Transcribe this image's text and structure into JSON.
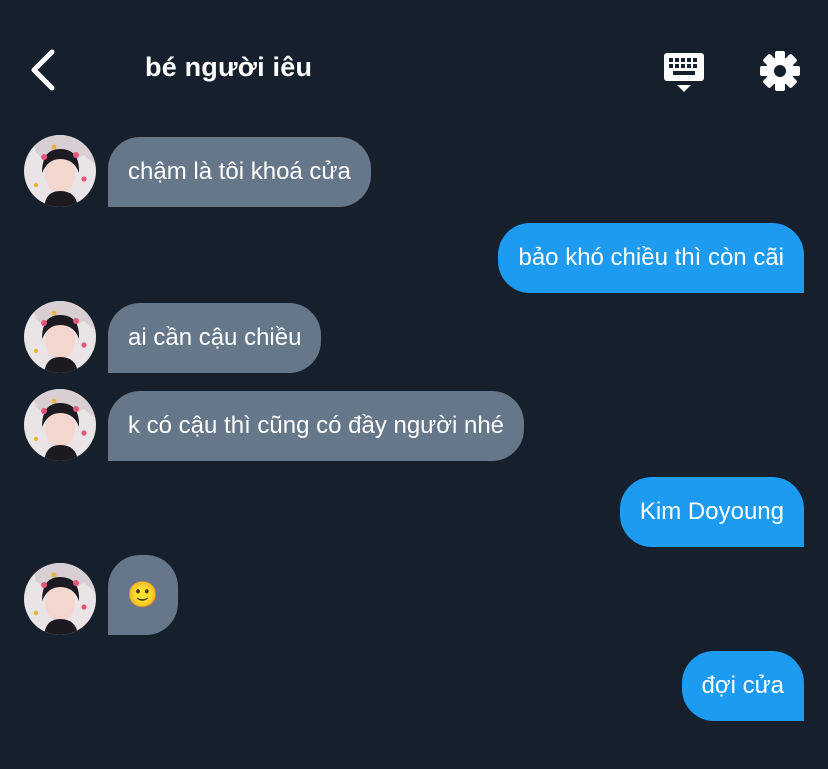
{
  "header": {
    "title": "bé người iêu"
  },
  "messages": [
    {
      "side": "in",
      "text": "chậm là tôi khoá cửa"
    },
    {
      "side": "out",
      "text": "bảo khó chiều thì còn cãi"
    },
    {
      "side": "in",
      "text": "ai cần cậu chiều"
    },
    {
      "side": "in",
      "text": "k có cậu thì cũng có đầy người nhé"
    },
    {
      "side": "out",
      "text": "Kim Doyoung"
    },
    {
      "side": "in",
      "text": "🙂"
    },
    {
      "side": "out",
      "text": "đợi cửa"
    }
  ],
  "colors": {
    "background": "#16202c",
    "incoming_bubble": "#66778a",
    "outgoing_bubble": "#1d9bf0",
    "text": "#ffffff"
  },
  "icons": {
    "back": "chevron-left-icon",
    "keyboard": "keyboard-icon",
    "settings": "gear-icon",
    "avatar": "avatar-photo"
  }
}
